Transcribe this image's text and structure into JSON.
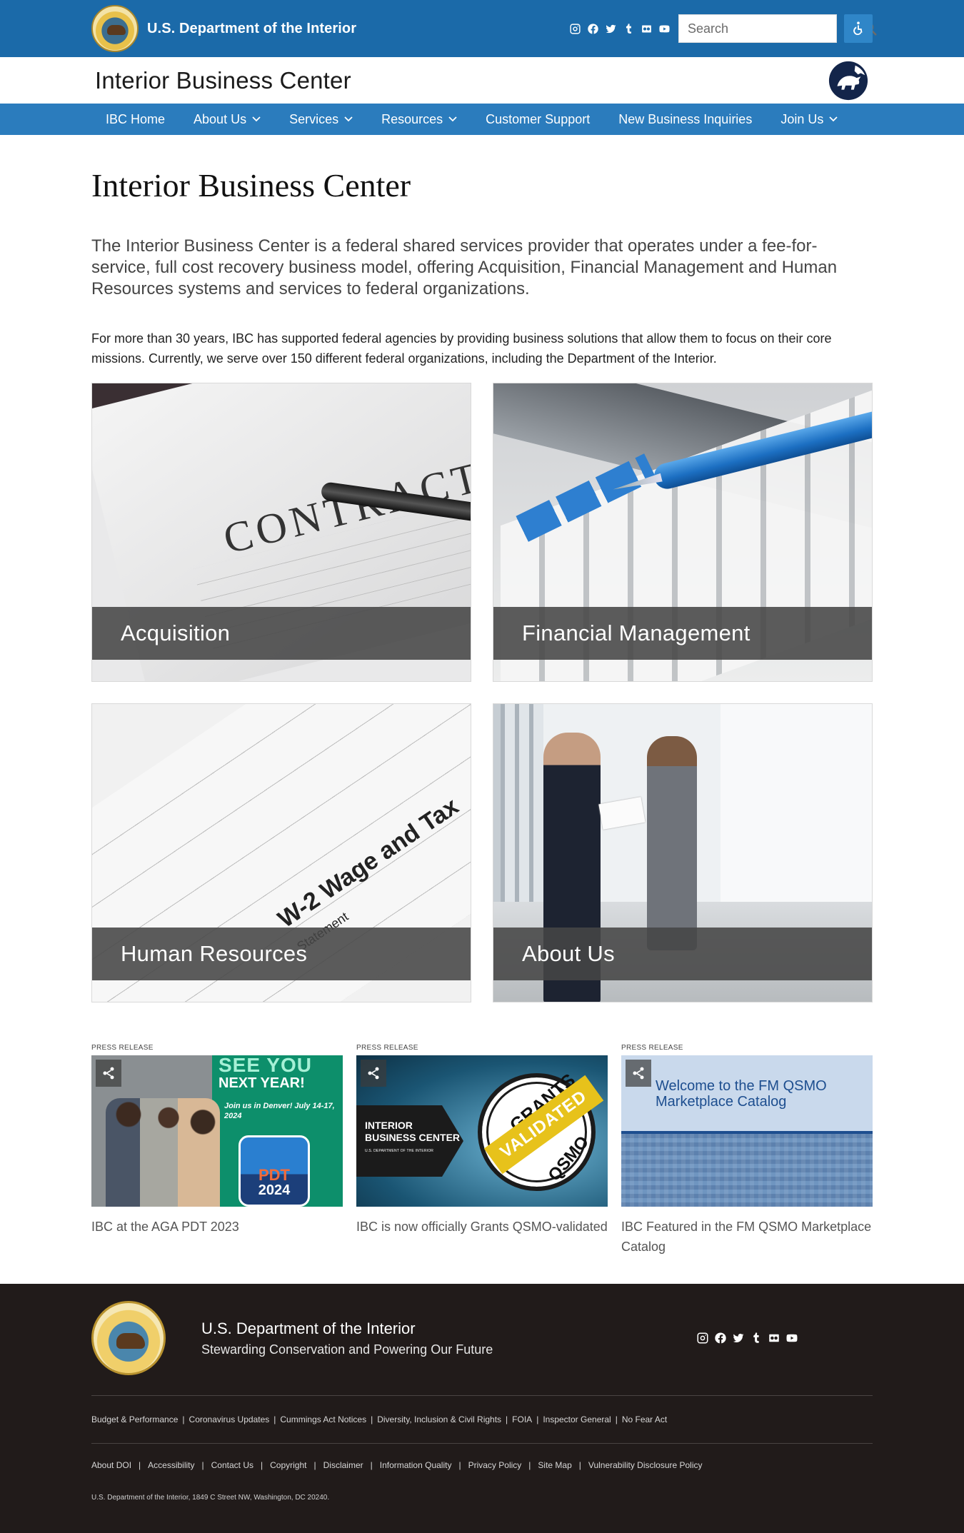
{
  "topbar": {
    "agency_name": "U.S. Department of the Interior",
    "social": [
      "instagram-icon",
      "facebook-icon",
      "twitter-icon",
      "tumblr-icon",
      "flickr-icon",
      "youtube-icon"
    ],
    "search_placeholder": "Search",
    "colors": {
      "background": "#1b6aa9",
      "accessibility_button": "#2f86c8"
    }
  },
  "header": {
    "site_title": "Interior Business Center"
  },
  "nav": {
    "items": [
      {
        "label": "IBC Home",
        "has_dropdown": false
      },
      {
        "label": "About Us",
        "has_dropdown": true
      },
      {
        "label": "Services",
        "has_dropdown": true
      },
      {
        "label": "Resources",
        "has_dropdown": true
      },
      {
        "label": "Customer Support",
        "has_dropdown": false
      },
      {
        "label": "New Business Inquiries",
        "has_dropdown": false
      },
      {
        "label": "Join Us",
        "has_dropdown": true
      }
    ],
    "color": "#2b7cbd"
  },
  "main": {
    "heading": "Interior Business Center",
    "lead": "The Interior Business Center is a federal shared services provider that operates under a fee-for-service, full cost recovery business model, offering Acquisition, Financial Management and Human Resources systems and services to federal organizations.",
    "body": "For more than 30 years, IBC has supported federal agencies by providing business solutions that allow them to focus on their core missions. Currently, we serve over 150 different federal organizations, including the Department of the Interior.",
    "tiles": [
      {
        "label": "Acquisition"
      },
      {
        "label": "Financial Management"
      },
      {
        "label": "Human Resources"
      },
      {
        "label": "About Us"
      }
    ]
  },
  "press": {
    "items": [
      {
        "kicker": "PRESS RELEASE",
        "title": "IBC at the AGA PDT 2023",
        "image_text": {
          "line1": "SEE YOU",
          "line2": "NEXT YEAR!",
          "line3": "Join us in Denver! July 14-17, 2024",
          "badge_a": "PDT",
          "badge_b": "2024"
        }
      },
      {
        "kicker": "PRESS RELEASE",
        "title": "IBC is now officially Grants QSMO-validated",
        "image_text": {
          "block": "INTERIOR BUSINESS CENTER",
          "block_small": "U.S. DEPARTMENT OF THE INTERIOR",
          "seal_top": "GRANTS",
          "stamp": "VALIDATED",
          "seal_bottom": "QSMO"
        }
      },
      {
        "kicker": "PRESS RELEASE",
        "title": "IBC Featured in the FM QSMO Marketplace Catalog",
        "image_text": {
          "welcome": "Welcome to the FM QSMO Marketplace Catalog"
        }
      }
    ]
  },
  "footer": {
    "dept": "U.S. Department of the Interior",
    "slogan": "Stewarding Conservation and Powering Our Future",
    "links_row1": [
      "Budget & Performance",
      "Coronavirus Updates",
      "Cummings Act Notices",
      "Diversity, Inclusion & Civil Rights",
      "FOIA",
      "Inspector General",
      "No Fear Act"
    ],
    "links_row2": [
      "About DOI",
      "Accessibility",
      "Contact Us",
      "Copyright",
      "Disclaimer",
      "Information Quality",
      "Privacy Policy",
      "Site Map",
      "Vulnerability Disclosure Policy"
    ],
    "address": "U.S. Department of the Interior, 1849 C Street NW, Washington, DC 20240.",
    "background": "#211b1a"
  }
}
